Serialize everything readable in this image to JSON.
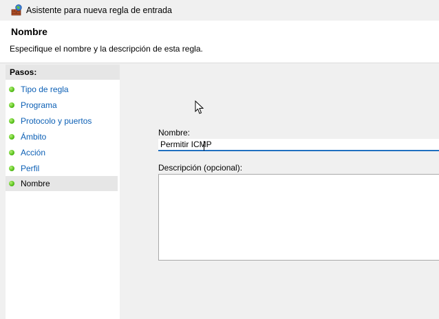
{
  "window": {
    "title": "Asistente para nueva regla de entrada",
    "icon": "firewall-wizard-icon"
  },
  "header": {
    "title": "Nombre",
    "description": "Especifique el nombre y la descripción de esta regla."
  },
  "sidebar": {
    "title": "Pasos:",
    "steps": [
      {
        "label": "Tipo de regla",
        "status": "done"
      },
      {
        "label": "Programa",
        "status": "done"
      },
      {
        "label": "Protocolo y puertos",
        "status": "done"
      },
      {
        "label": "Ámbito",
        "status": "done"
      },
      {
        "label": "Acción",
        "status": "done"
      },
      {
        "label": "Perfil",
        "status": "done"
      },
      {
        "label": "Nombre",
        "status": "current"
      }
    ],
    "step_dot_color": "#5cc51f",
    "link_color": "#0b5fb5"
  },
  "form": {
    "name_label": "Nombre:",
    "name_value": "Permitir ICMP",
    "description_label": "Descripción (opcional):",
    "description_value": ""
  },
  "colors": {
    "accent": "#1f6fc0",
    "header_background": "#ffffff",
    "window_background": "#f0f0f0"
  }
}
